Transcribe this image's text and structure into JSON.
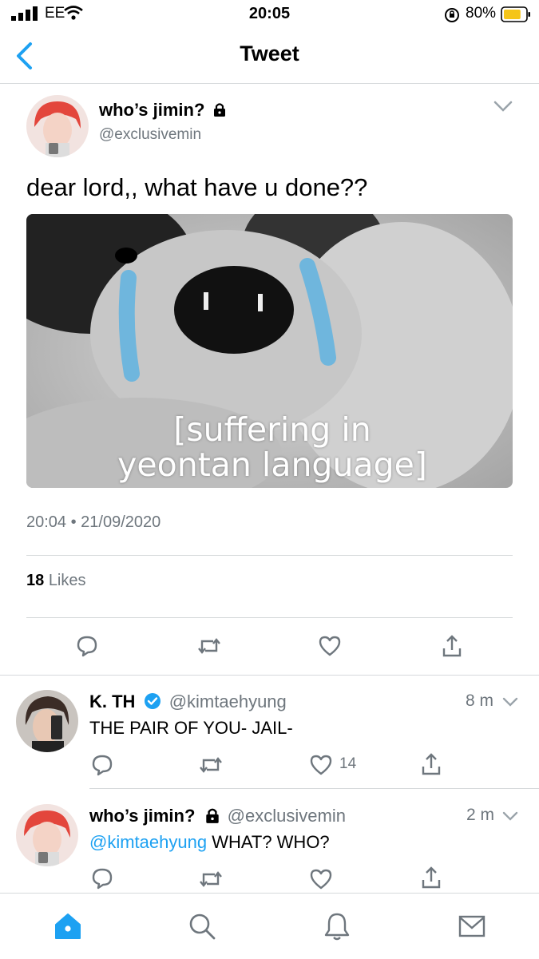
{
  "status_bar": {
    "carrier": "EE",
    "time": "20:05",
    "battery_percent": "80%",
    "battery_level": 0.8
  },
  "nav": {
    "title": "Tweet"
  },
  "main_tweet": {
    "display_name": "who’s jimin?",
    "handle": "@exclusivemin",
    "text": "dear lord,, what have u done??",
    "image_caption_line1": "[suffering in",
    "image_caption_line2": "yeontan language]",
    "timestamp": "20:04 • 21/09/2020",
    "likes_count": "18",
    "likes_label": "Likes"
  },
  "replies": [
    {
      "display_name": "K. TH",
      "handle": "@kimtaehyung",
      "time": "8 m",
      "text": "THE PAIR OF YOU- JAIL-",
      "like_count": "14"
    },
    {
      "display_name": "who’s jimin?",
      "handle": "@exclusivemin",
      "time": "2 m",
      "mention": "@kimtaehyung",
      "text": " WHAT? WHO?"
    }
  ],
  "colors": {
    "accent": "#1da1f2",
    "muted": "#6e767d",
    "divider": "#d6d9db",
    "battery": "#f5c518"
  }
}
